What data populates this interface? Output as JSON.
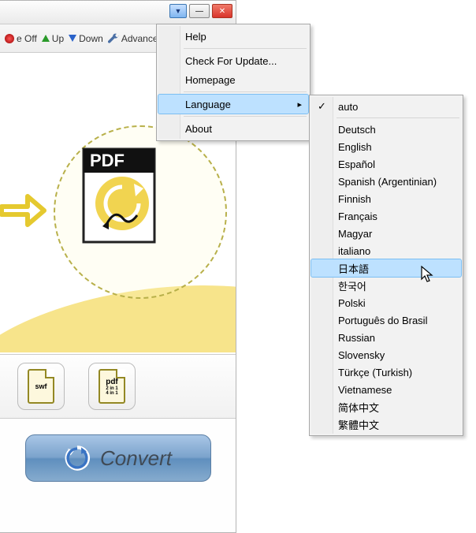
{
  "toolbar": {
    "off": "e Off",
    "up": "Up",
    "down": "Down",
    "advanced": "Advance"
  },
  "menu": {
    "help": "Help",
    "check_update": "Check For Update...",
    "homepage": "Homepage",
    "language": "Language",
    "about": "About"
  },
  "languages": [
    "auto",
    "Deutsch",
    "English",
    "Español",
    "Spanish (Argentinian)",
    "Finnish",
    "Français",
    "Magyar",
    "italiano",
    "日本語",
    "한국어",
    "Polski",
    "Português do Brasil",
    "Russian",
    "Slovensky",
    "Türkçe (Turkish)",
    "Vietnamese",
    "简体中文",
    "繁體中文"
  ],
  "selected_lang_index": 0,
  "highlighted_lang_index": 9,
  "formats": {
    "swf": "swf",
    "pdf": "pdf",
    "pdf_sub": "2 in 1\n4 in 1"
  },
  "convert_label": "Convert",
  "pdf_label": "PDF"
}
